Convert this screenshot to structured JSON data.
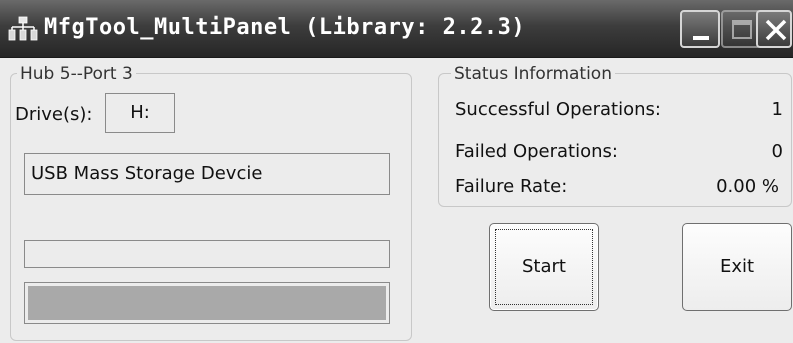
{
  "window": {
    "title": "MfgTool_MultiPanel (Library: 2.2.3)",
    "icon": "hierarchy-icon"
  },
  "titlebar_buttons": [
    "minimize",
    "maximize",
    "close"
  ],
  "port_group": {
    "legend": "Hub 5--Port 3",
    "drives_label": "Drive(s):",
    "drive_value": "H:",
    "device_description": "USB Mass Storage Devcie",
    "progress_1": 0,
    "progress_2": 1
  },
  "status_group": {
    "legend": "Status Information",
    "successful_label": "Successful Operations:",
    "successful_value": "1",
    "failed_label": "Failed Operations:",
    "failed_value": "0",
    "rate_label": "Failure Rate:",
    "rate_value": "0.00 %"
  },
  "buttons": {
    "start": "Start",
    "exit": "Exit"
  }
}
